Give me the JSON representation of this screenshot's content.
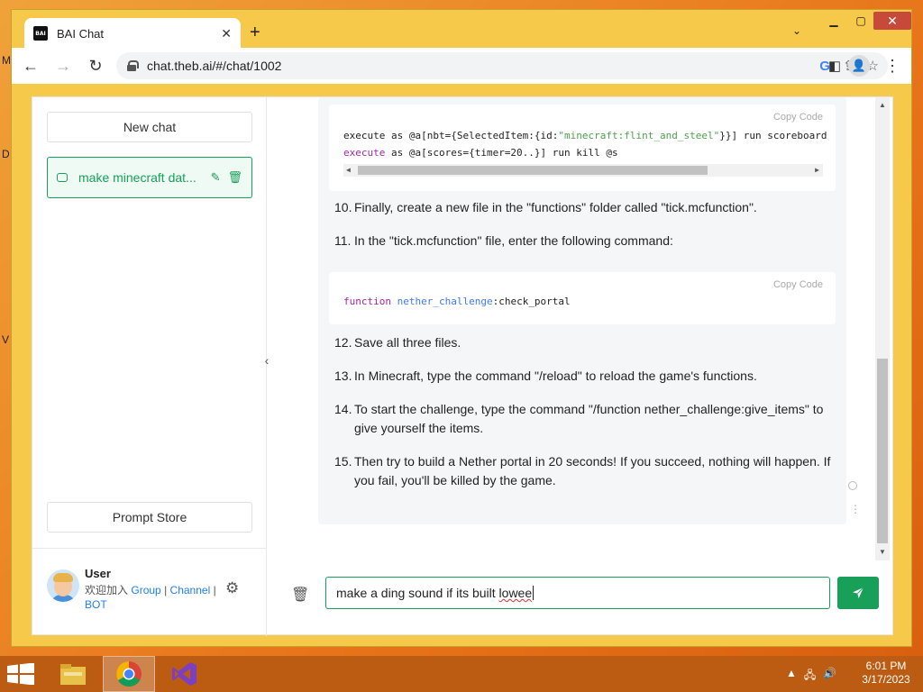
{
  "desktop": {
    "icon_texts": [
      "M",
      "D",
      "V"
    ]
  },
  "browser": {
    "tab_title": "BAI Chat",
    "favicon_text": "BAI",
    "url": "chat.theb.ai/#/chat/1002"
  },
  "sidebar": {
    "new_chat_label": "New chat",
    "chat_items": [
      {
        "label": "make minecraft dat..."
      }
    ],
    "prompt_store_label": "Prompt Store",
    "user": {
      "name": "User",
      "welcome": "欢迎加入",
      "links": [
        "Group",
        "Channel",
        "BOT"
      ],
      "separator": "|"
    }
  },
  "messages": {
    "copy_label": "Copy",
    "code_label": "Code",
    "code_block_1": {
      "line1_a": "execute as @a[nbt={SelectedItem:{id:",
      "line1_str": "\"minecraft:flint_and_steel\"",
      "line1_b": "}}] run scoreboard",
      "line2_kw": "execute",
      "line2_rest": " as @a[scores={timer=20..}] run kill @s"
    },
    "code_block_2": {
      "kw": "function",
      "ns": "nether_challenge",
      "rest": ":check_portal"
    },
    "steps": [
      {
        "num": "10.",
        "text": "Finally, create a new file in the \"functions\" folder called \"tick.mcfunction\"."
      },
      {
        "num": "11.",
        "text": "In the \"tick.mcfunction\" file, enter the following command:"
      },
      {
        "num": "12.",
        "text": "Save all three files."
      },
      {
        "num": "13.",
        "text": "In Minecraft, type the command \"/reload\" to reload the game's functions."
      },
      {
        "num": "14.",
        "text": "To start the challenge, type the command \"/function nether_challenge:give_items\" to",
        "text2": "give yourself the items."
      },
      {
        "num": "15.",
        "text": "Then try to build a Nether portal in 20 seconds! If you succeed, nothing will happen. If",
        "text2": "you fail, you'll be killed by the game."
      }
    ]
  },
  "input": {
    "value_prefix": "make a ding sound if its built ",
    "value_misspelled": "lowee"
  },
  "taskbar": {
    "time": "6:01 PM",
    "date": "3/17/2023"
  },
  "colors": {
    "accent": "#18a058",
    "link": "#2080f0"
  }
}
